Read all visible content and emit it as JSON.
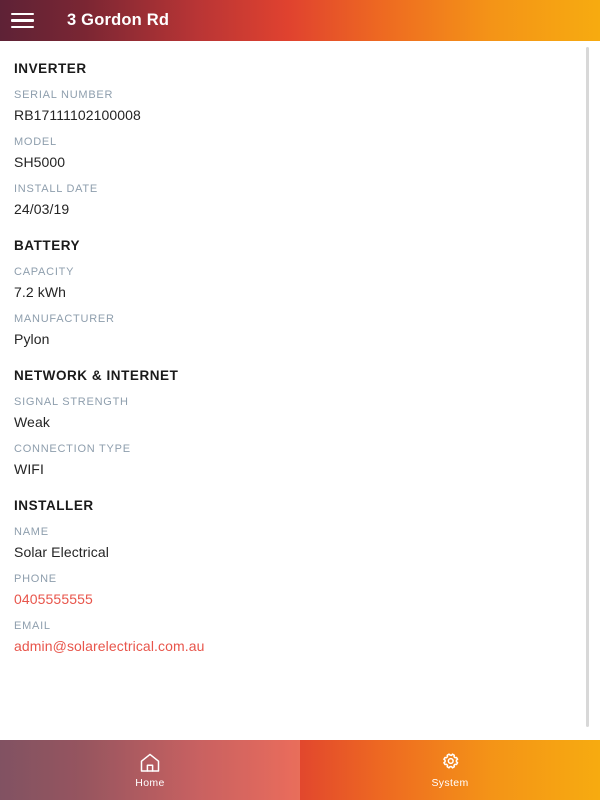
{
  "header": {
    "title": "3 Gordon Rd",
    "menu_icon": "hamburger-menu-icon",
    "gradient_start": "#5e2236",
    "gradient_mid": "#e0422f",
    "gradient_end": "#f7ab10"
  },
  "colors": {
    "label": "#8e9ead",
    "value": "#242424",
    "link": "#e8554b",
    "heading": "#1a1a1a",
    "background": "#ffffff"
  },
  "sections": [
    {
      "title": "INVERTER",
      "fields": [
        {
          "label": "SERIAL NUMBER",
          "value": "RB17111102100008",
          "link": false
        },
        {
          "label": "MODEL",
          "value": "SH5000",
          "link": false
        },
        {
          "label": "INSTALL DATE",
          "value": "24/03/19",
          "link": false
        }
      ]
    },
    {
      "title": "BATTERY",
      "fields": [
        {
          "label": "CAPACITY",
          "value": "7.2 kWh",
          "link": false
        },
        {
          "label": "MANUFACTURER",
          "value": "Pylon",
          "link": false
        }
      ]
    },
    {
      "title": "NETWORK & INTERNET",
      "fields": [
        {
          "label": "SIGNAL STRENGTH",
          "value": "Weak",
          "link": false
        },
        {
          "label": "CONNECTION TYPE",
          "value": "WIFI",
          "link": false
        }
      ]
    },
    {
      "title": "INSTALLER",
      "fields": [
        {
          "label": "NAME",
          "value": "Solar Electrical",
          "link": false
        },
        {
          "label": "PHONE",
          "value": "0405555555",
          "link": true
        },
        {
          "label": "EMAIL",
          "value": "admin@solarelectrical.com.au",
          "link": true
        }
      ]
    }
  ],
  "bottom_nav": {
    "items": [
      {
        "label": "Home",
        "icon": "home-icon",
        "active": false
      },
      {
        "label": "System",
        "icon": "gear-icon",
        "active": true
      }
    ]
  }
}
